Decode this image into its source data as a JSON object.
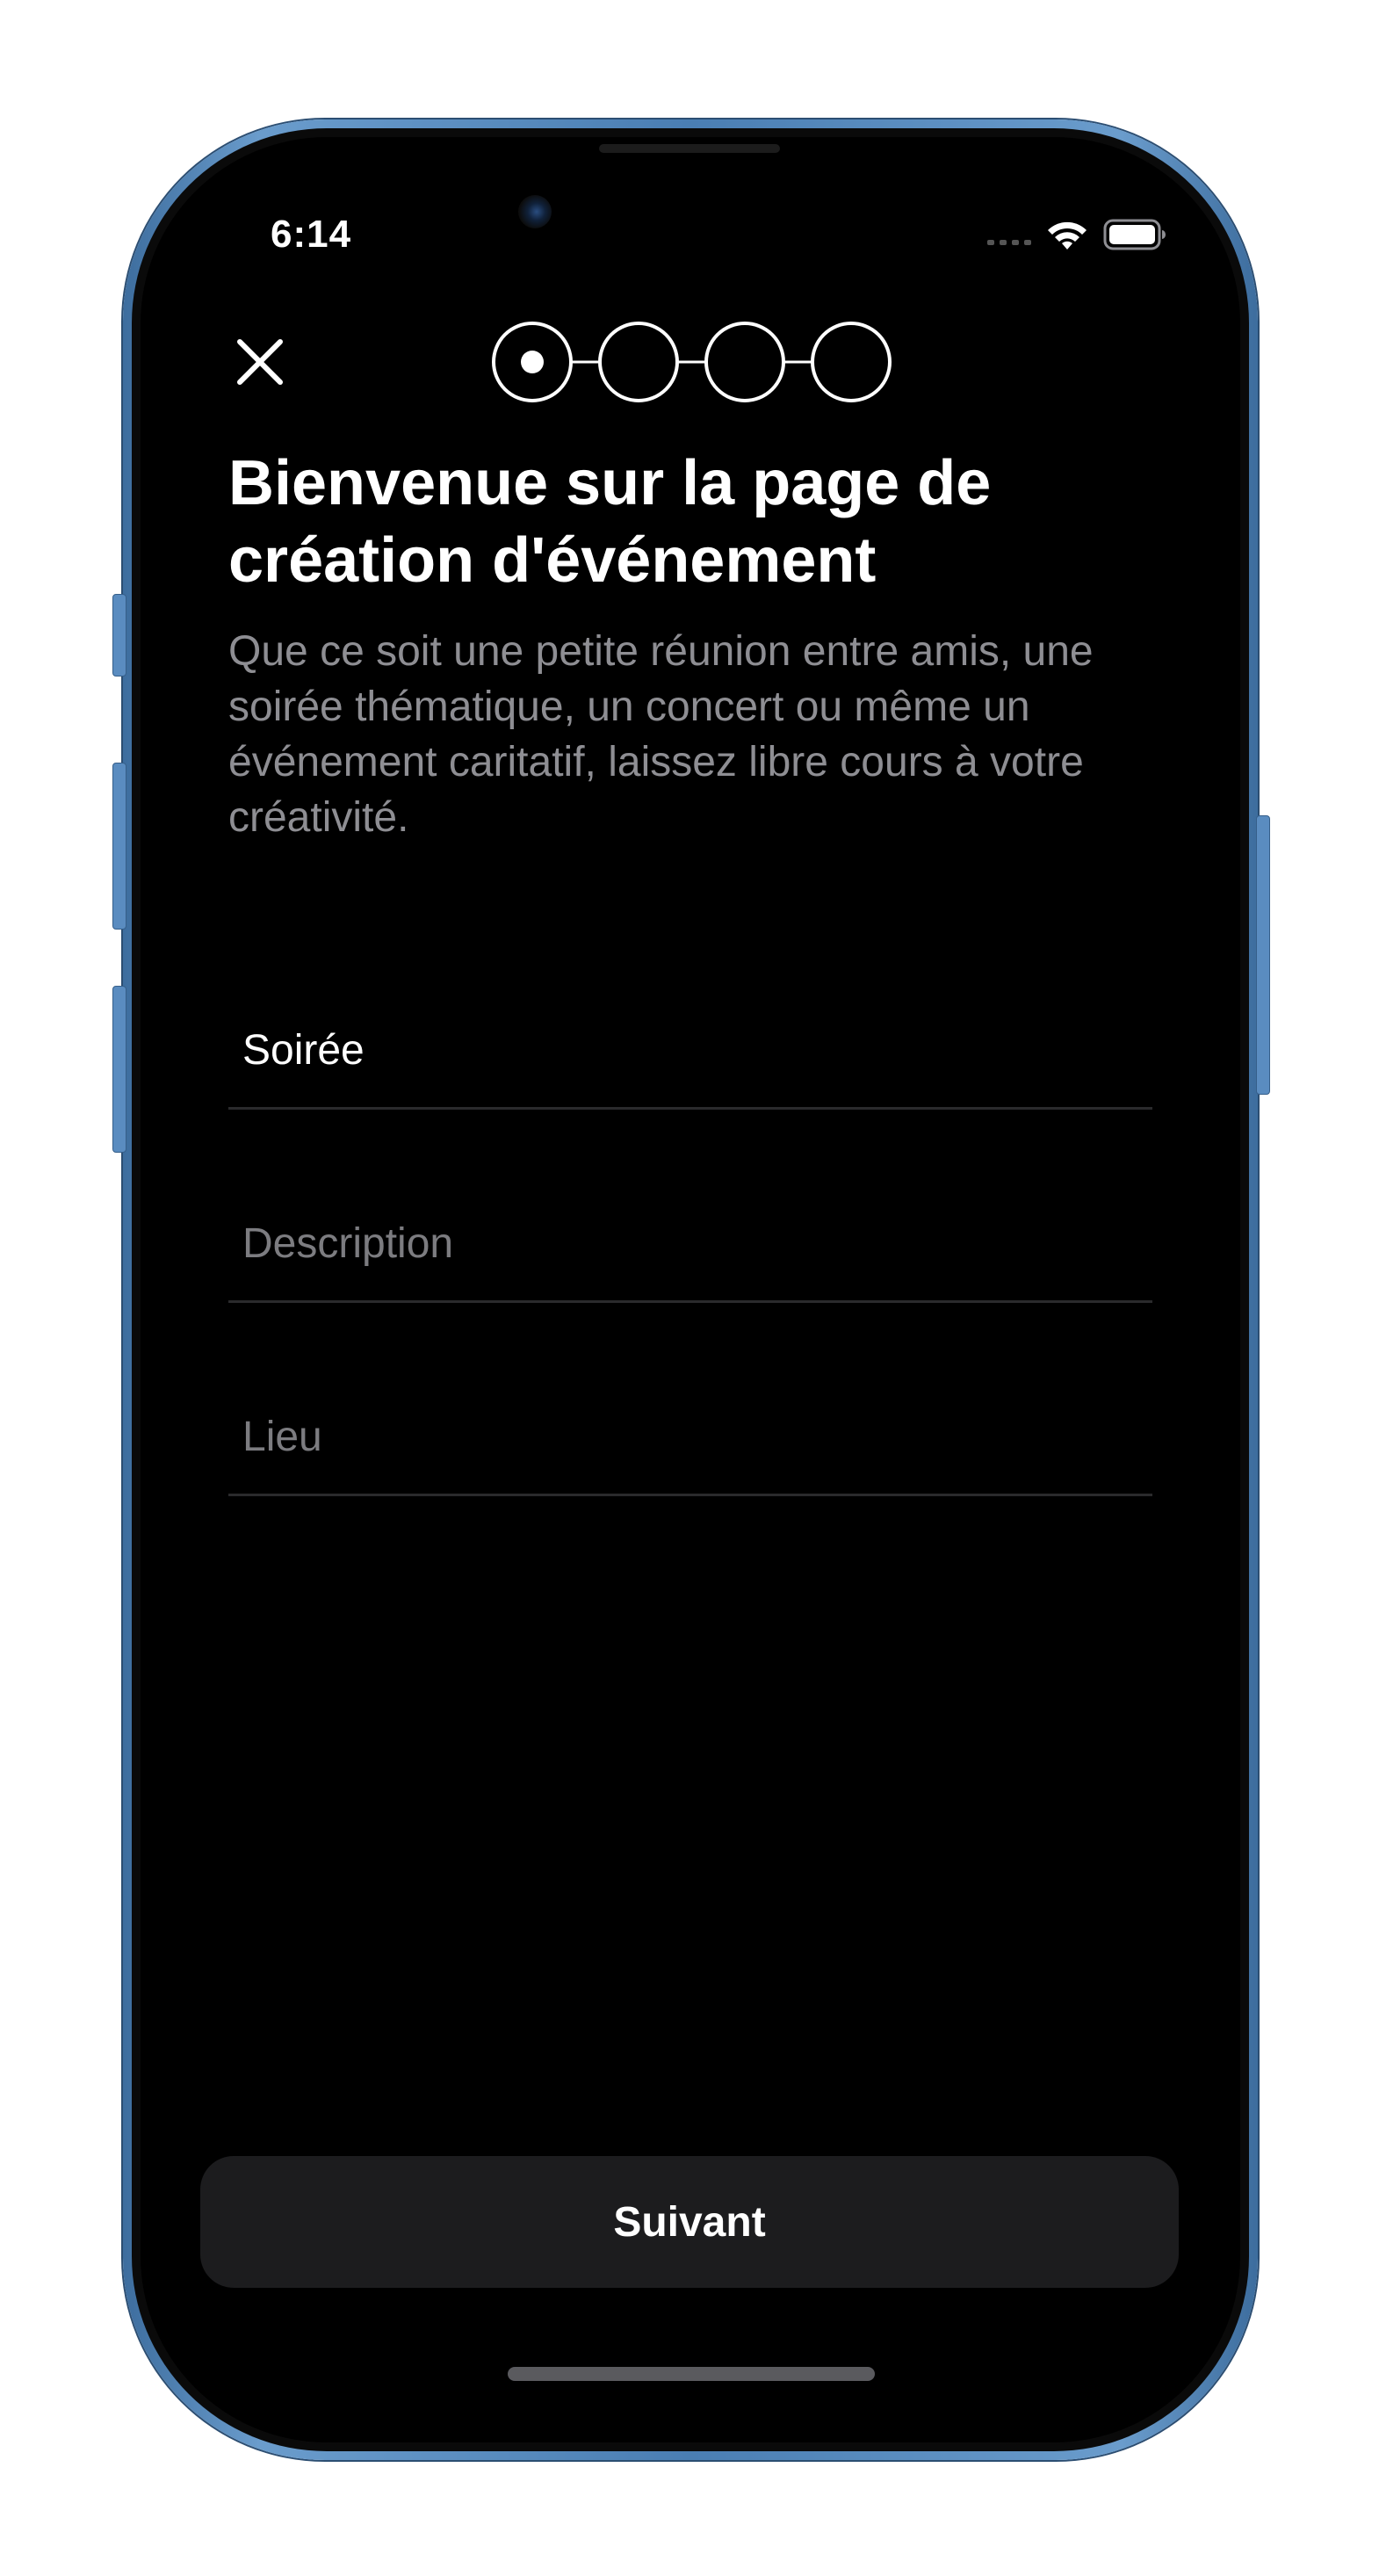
{
  "status_bar": {
    "time": "6:14",
    "wifi_icon": "wifi-icon",
    "battery_icon": "battery-icon"
  },
  "header": {
    "close_icon": "close-icon",
    "steps_total": 4,
    "current_step": 1
  },
  "content": {
    "title": "Bienvenue sur la page de création d'événement",
    "subtitle": "Que ce soit une petite réunion entre amis, une soirée thématique, un concert ou même un événement caritatif, laissez libre cours à votre créativité."
  },
  "form": {
    "name": {
      "value": "Soirée",
      "placeholder": ""
    },
    "description": {
      "value": "",
      "placeholder": "Description"
    },
    "location": {
      "value": "",
      "placeholder": "Lieu"
    }
  },
  "footer": {
    "next_label": "Suivant"
  },
  "colors": {
    "frame": "#4a7eb3",
    "background": "#000000",
    "secondary_text": "#8e8e93",
    "button": "#1c1c1e"
  }
}
